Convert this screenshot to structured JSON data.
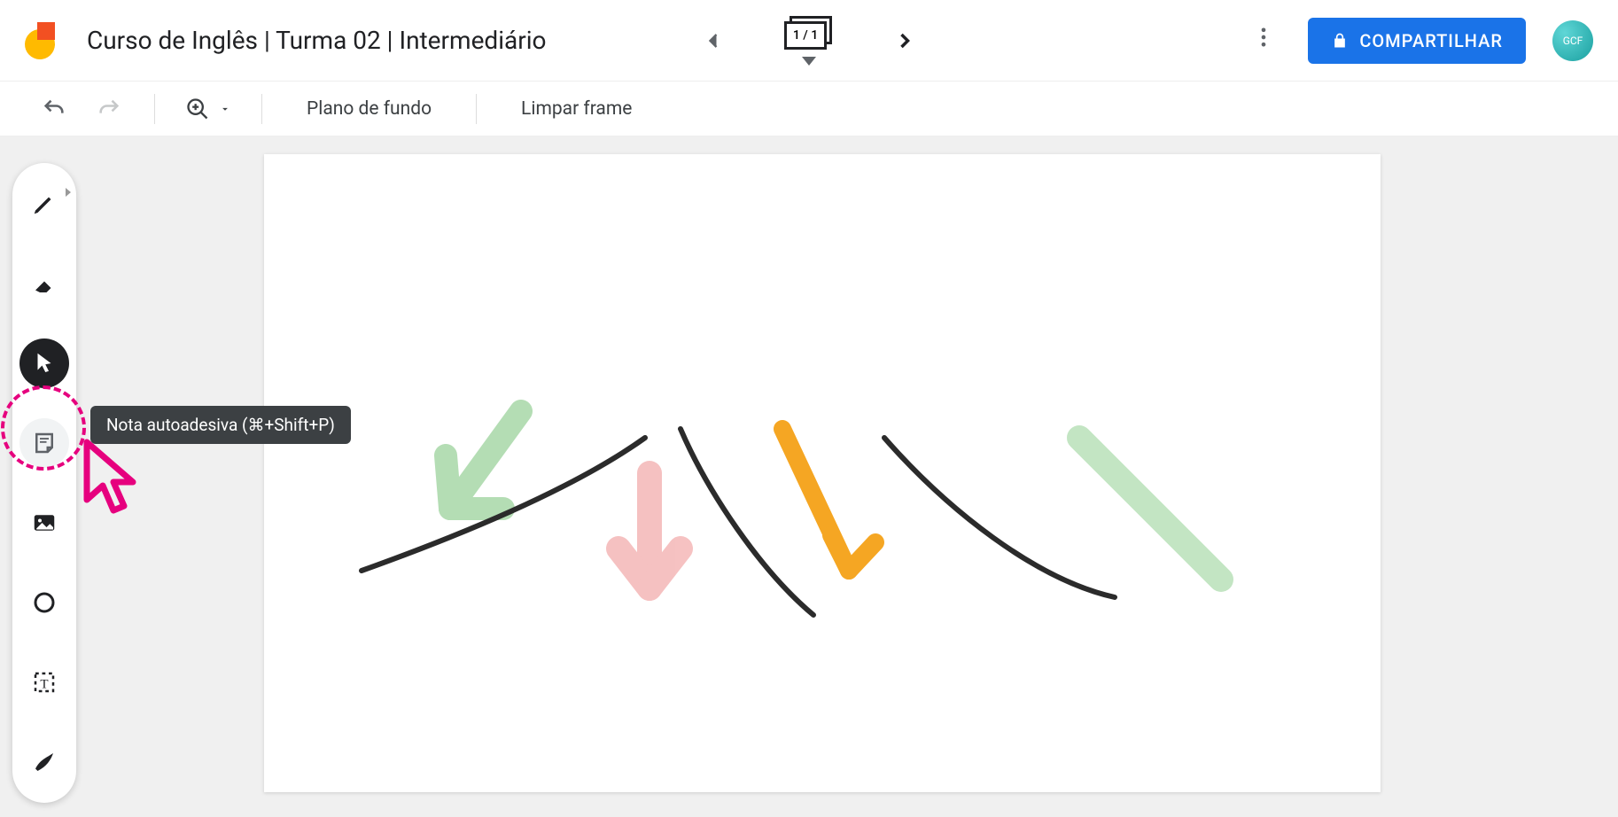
{
  "header": {
    "doc_title": "Curso de Inglês | Turma 02 | Intermediário",
    "frame_counter": "1 / 1",
    "share_label": "COMPARTILHAR",
    "avatar_label": "GCF"
  },
  "toolbar2": {
    "background_label": "Plano de fundo",
    "clear_frame_label": "Limpar frame"
  },
  "tooltip": {
    "sticky_note": "Nota autoadesiva (⌘+Shift+P)"
  },
  "tools": {
    "pen": "pen",
    "eraser": "eraser",
    "select": "select",
    "sticky_note": "sticky-note",
    "image": "image",
    "shape": "shape",
    "textbox": "textbox",
    "laser": "laser"
  }
}
